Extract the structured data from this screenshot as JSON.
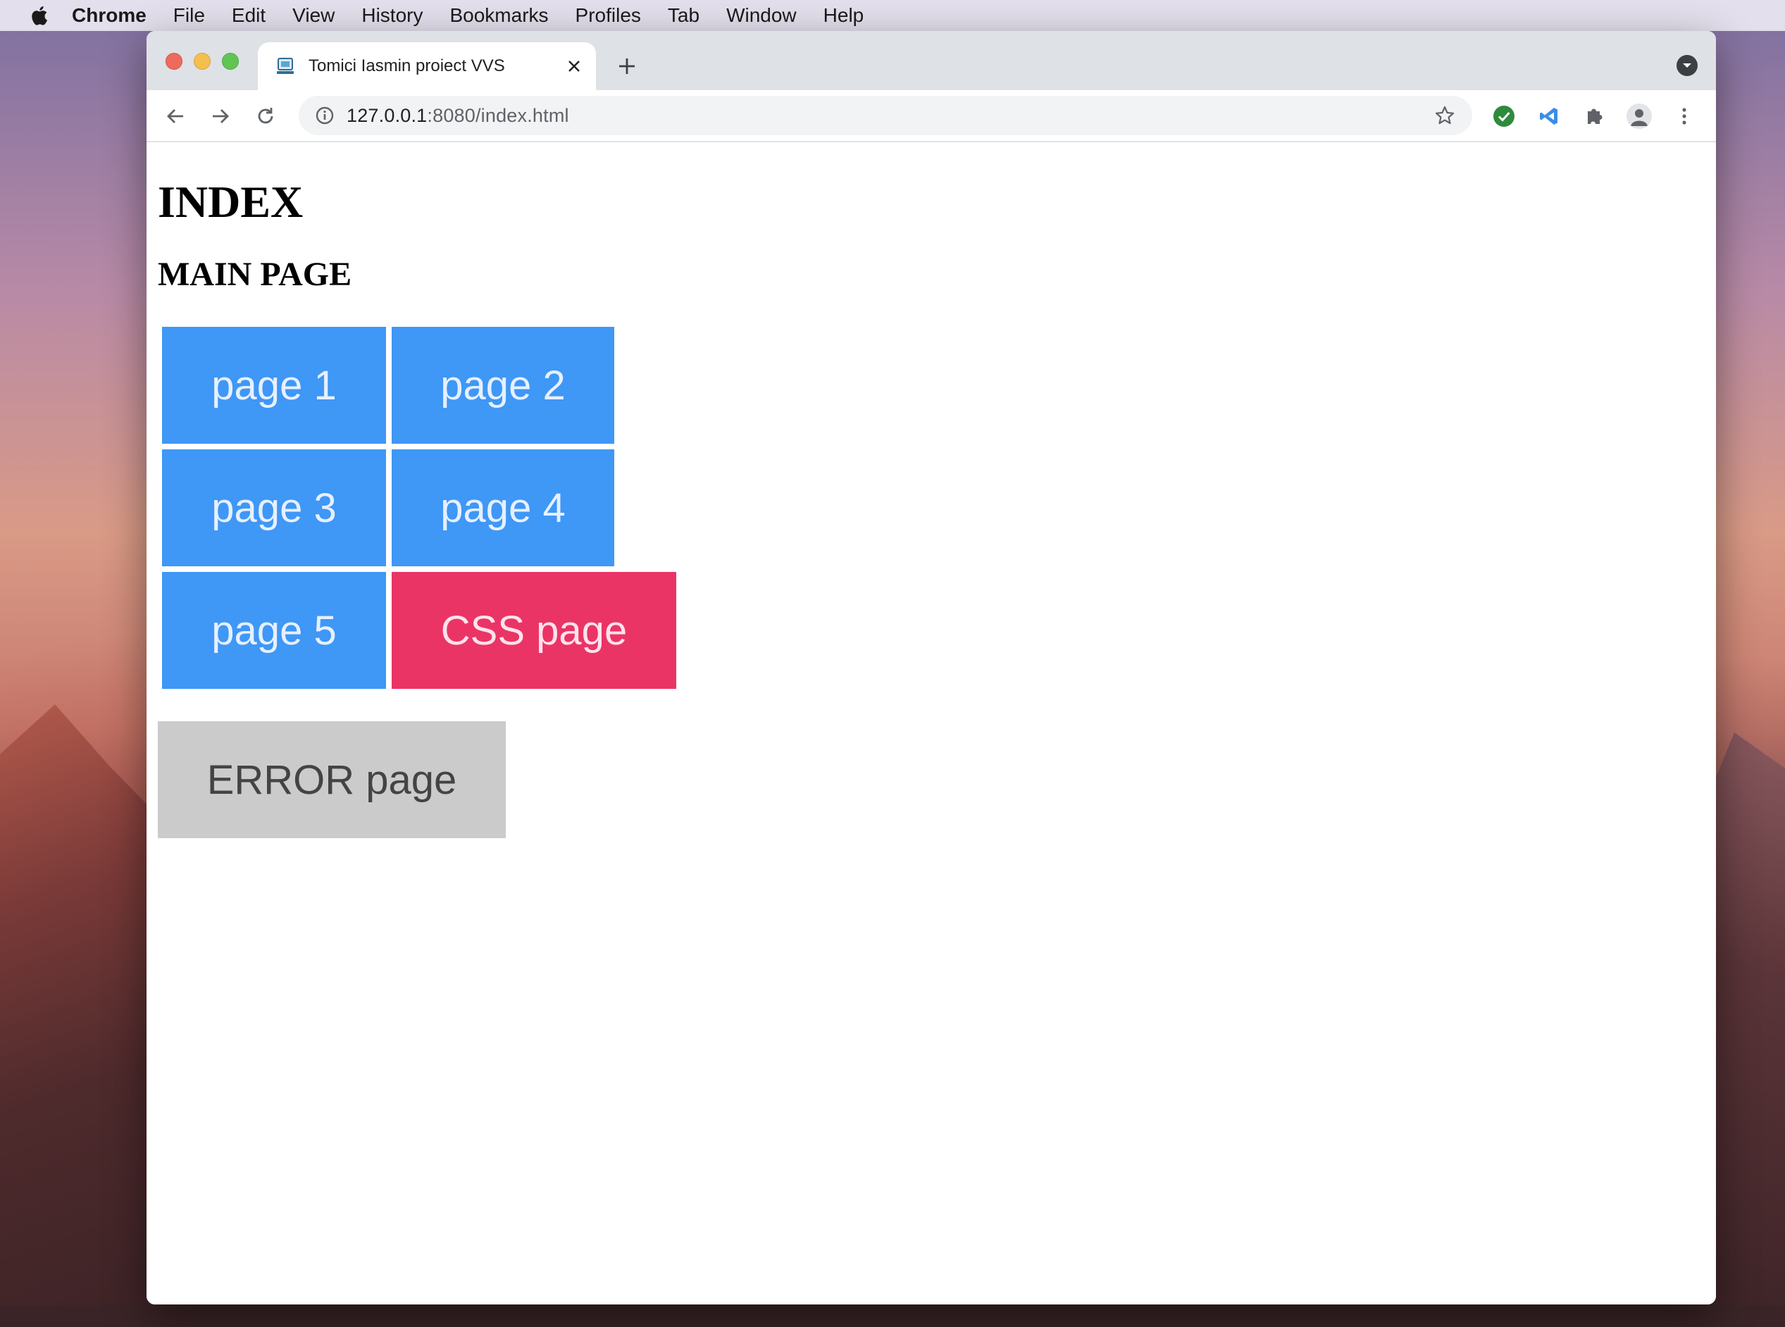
{
  "menubar": {
    "app": "Chrome",
    "items": [
      "File",
      "Edit",
      "View",
      "History",
      "Bookmarks",
      "Profiles",
      "Tab",
      "Window",
      "Help"
    ]
  },
  "browser": {
    "tab_title": "Tomici Iasmin proiect VVS",
    "url_host": "127.0.0.1",
    "url_path": ":8080/index.html",
    "toolbar_icons": [
      "back-icon",
      "forward-icon",
      "reload-icon",
      "site-info-icon",
      "bookmark-star-icon",
      "extension-check-icon",
      "extension-vscode-icon",
      "extensions-puzzle-icon",
      "profile-icon",
      "menu-dots-icon"
    ]
  },
  "page": {
    "heading": "INDEX",
    "subheading": "MAIN PAGE",
    "buttons": [
      {
        "label": "page 1"
      },
      {
        "label": "page 2"
      },
      {
        "label": "page 3"
      },
      {
        "label": "page 4"
      },
      {
        "label": "page 5"
      },
      {
        "label": "CSS page"
      },
      {
        "label": "ERROR page"
      }
    ]
  },
  "colors": {
    "nav_button": "#3f97f6",
    "css_button": "#eb3466",
    "error_button": "#cbcbcb"
  }
}
